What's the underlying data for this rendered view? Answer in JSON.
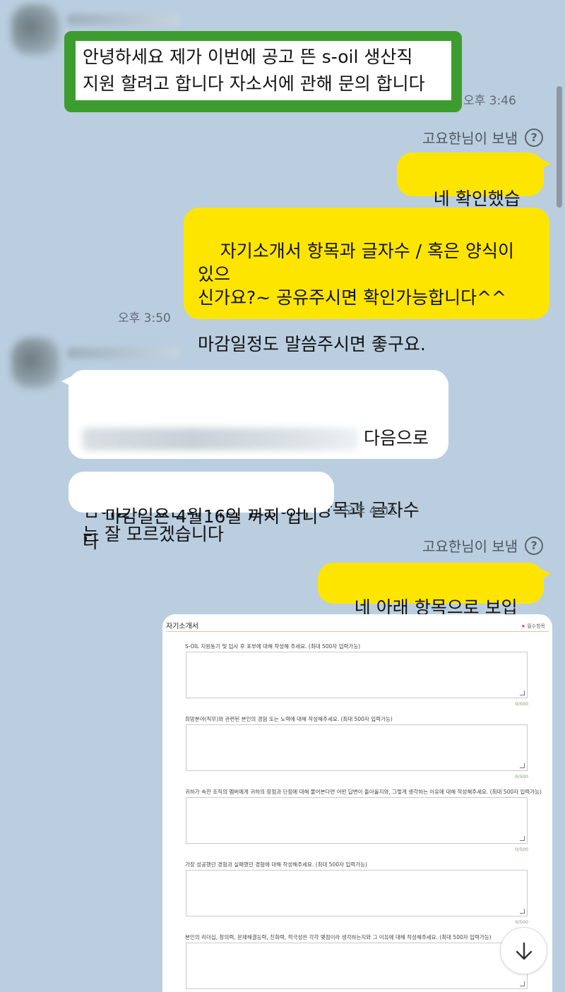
{
  "messages": {
    "m1_text": "안녕하세요 제가 이번에 공고 뜬 s-oil 생산직\n지원 할려고 합니다 자소서에 관해 문의 합니다",
    "m1_time": "오후 3:46",
    "sent_label_1": "고요한님이 보냄",
    "m2_text": "네 확인했습니다.",
    "m3_text": "자기소개서 항목과 글자수 / 혹은 양식이 있으\n신가요?~ 공유주시면 확인가능합니다^^\n\n마감일정도 말씀주시면 좋구요.",
    "m3_time": "오후 3:50",
    "m4_line1_tail": "다음으로",
    "m4_rest": "넘어갈수 있는데 지금 일중이라 항목과 글자수\n는 잘 모르겠습니다",
    "m5_text": "마감일은 4월16일 까지 입니다",
    "m5_time": "오후 4:02",
    "sent_label_2": "고요한님이 보냄",
    "m6_text": "네 아래 항목으로 보입니다."
  },
  "help_glyph": "?",
  "form": {
    "title": "자기소개서",
    "required_star": "★",
    "required_label": "필수항목",
    "questions": [
      {
        "label": "S-OIL 지원동기 및 입사 후 포부에 대해 작성해 주세요. (최대 500자 입력가능)",
        "count": "0/500"
      },
      {
        "label": "희망분야(직무)와 관련된 본인의 경험 또는 노력에 대해 작성해주세요. (최대 500자 입력가능)",
        "count": "0/500"
      },
      {
        "label": "귀하가 속한 조직의 멤버에게 귀하의 장점과 단점에 대해 물어본다면 어떤 답변이 돌아올지와, 그렇게 생각하는 이유에 대해 작성해주세요. (최대 500자 입력가능)",
        "count": "0/500"
      },
      {
        "label": "가장 성공했던 경험과 실패했던 경험에 대해 작성해주세요. (최대 500자 입력가능)",
        "count": "0/500"
      },
      {
        "label": "본인의 리더십, 창의력, 문제해결능력, 친화력, 적극성은 각각 몇점이라 생각하는지와 그 이유에 대해 작성해주세요. (최대 500자 입력가능)",
        "count": ""
      }
    ]
  },
  "icons": {
    "scroll_down": "arrow-down-icon",
    "help": "question-circle-icon"
  },
  "colors": {
    "background": "#bacee0",
    "outgoing_bubble": "#fee500",
    "incoming_bubble": "#ffffff",
    "highlight_border": "#3d9c2e"
  }
}
